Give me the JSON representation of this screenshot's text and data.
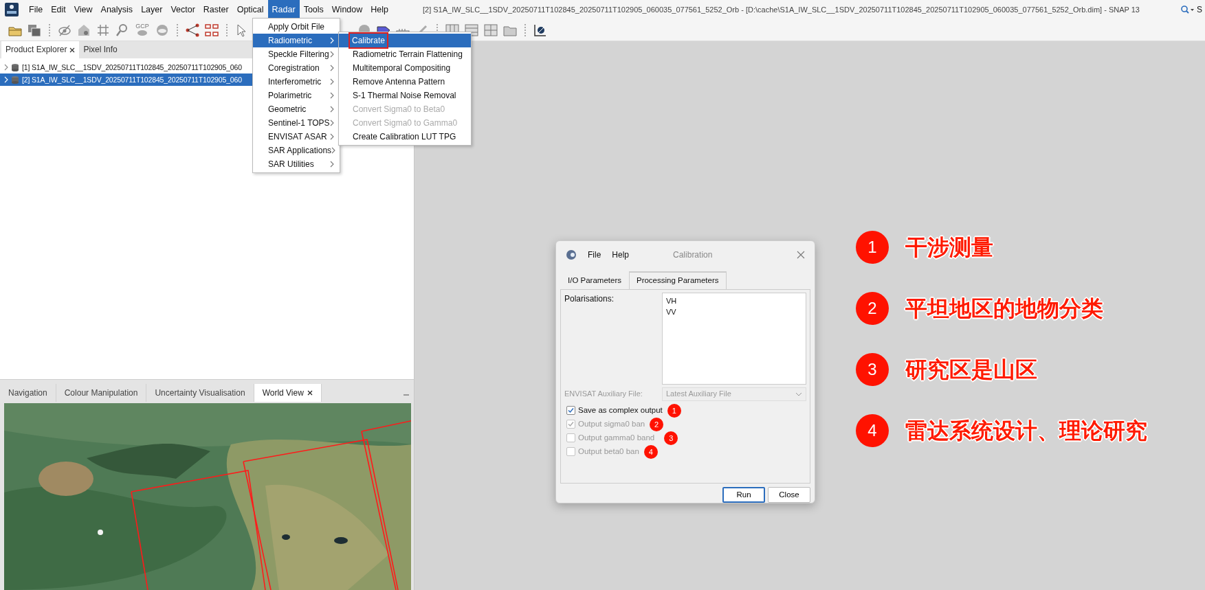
{
  "window": {
    "title": "[2] S1A_IW_SLC__1SDV_20250711T102845_20250711T102905_060035_077561_5252_Orb - [D:\\cache\\S1A_IW_SLC__1SDV_20250711T102845_20250711T102905_060035_077561_5252_Orb.dim] - SNAP 13"
  },
  "menu_bar": [
    {
      "label": "File",
      "selected": false
    },
    {
      "label": "Edit",
      "selected": false
    },
    {
      "label": "View",
      "selected": false
    },
    {
      "label": "Analysis",
      "selected": false
    },
    {
      "label": "Layer",
      "selected": false
    },
    {
      "label": "Vector",
      "selected": false
    },
    {
      "label": "Raster",
      "selected": false
    },
    {
      "label": "Optical",
      "selected": false
    },
    {
      "label": "Radar",
      "selected": true
    },
    {
      "label": "Tools",
      "selected": false
    },
    {
      "label": "Window",
      "selected": false
    },
    {
      "label": "Help",
      "selected": false
    }
  ],
  "toolbar": {
    "gcp_label": "GCP"
  },
  "search": {
    "placeholder": "S"
  },
  "radar_menu": [
    {
      "label": "Apply Orbit File",
      "submenu": false,
      "selected": false
    },
    {
      "label": "Radiometric",
      "submenu": true,
      "selected": true
    },
    {
      "label": "Speckle Filtering",
      "submenu": true,
      "selected": false
    },
    {
      "label": "Coregistration",
      "submenu": true,
      "selected": false
    },
    {
      "label": "Interferometric",
      "submenu": true,
      "selected": false
    },
    {
      "label": "Polarimetric",
      "submenu": true,
      "selected": false
    },
    {
      "label": "Geometric",
      "submenu": true,
      "selected": false
    },
    {
      "label": "Sentinel-1 TOPS",
      "submenu": true,
      "selected": false
    },
    {
      "label": "ENVISAT ASAR",
      "submenu": true,
      "selected": false
    },
    {
      "label": "SAR Applications",
      "submenu": true,
      "selected": false
    },
    {
      "label": "SAR Utilities",
      "submenu": true,
      "selected": false
    }
  ],
  "radiometric_submenu": [
    {
      "label": "Calibrate",
      "selected": true,
      "highlighted": true,
      "disabled": false
    },
    {
      "label": "Radiometric Terrain Flattening",
      "selected": false,
      "highlighted": false,
      "disabled": false
    },
    {
      "label": "Multitemporal Compositing",
      "selected": false,
      "highlighted": false,
      "disabled": false
    },
    {
      "label": "Remove Antenna Pattern",
      "selected": false,
      "highlighted": false,
      "disabled": false
    },
    {
      "label": "S-1 Thermal Noise Removal",
      "selected": false,
      "highlighted": false,
      "disabled": false
    },
    {
      "label": "Convert Sigma0 to Beta0",
      "selected": false,
      "highlighted": false,
      "disabled": true
    },
    {
      "label": "Convert Sigma0 to Gamma0",
      "selected": false,
      "highlighted": false,
      "disabled": true
    },
    {
      "label": "Create Calibration LUT TPG",
      "selected": false,
      "highlighted": false,
      "disabled": false
    }
  ],
  "product_explorer": {
    "tabs": [
      {
        "label": "Product Explorer",
        "closable": true,
        "selected": true
      },
      {
        "label": "Pixel Info",
        "closable": false,
        "selected": false
      }
    ],
    "products": [
      {
        "label": "[1] S1A_IW_SLC__1SDV_20250711T102845_20250711T102905_060",
        "selected": false
      },
      {
        "label": "[2] S1A_IW_SLC__1SDV_20250711T102845_20250711T102905_060",
        "selected": true
      }
    ]
  },
  "bottom_panel": {
    "tabs": [
      {
        "label": "Navigation",
        "closable": false,
        "selected": false
      },
      {
        "label": "Colour Manipulation",
        "closable": false,
        "selected": false
      },
      {
        "label": "Uncertainty Visualisation",
        "closable": false,
        "selected": false
      },
      {
        "label": "World View",
        "closable": true,
        "selected": true
      }
    ]
  },
  "dialog": {
    "menu": [
      "File",
      "Help"
    ],
    "title": "Calibration",
    "tabs": [
      {
        "label": "I/O Parameters",
        "selected": false
      },
      {
        "label": "Processing Parameters",
        "selected": true
      }
    ],
    "polarisations_label": "Polarisations:",
    "polarisations": [
      "VH",
      "VV"
    ],
    "aux_label": "ENVISAT Auxiliary File:",
    "aux_value": "Latest Auxiliary File",
    "aux_disabled": true,
    "options": [
      {
        "label": "Save as complex output",
        "checked": true,
        "disabled": false,
        "badge": "1"
      },
      {
        "label": "Output sigma0 ban",
        "checked": true,
        "disabled": true,
        "badge": "2"
      },
      {
        "label": "Output gamma0 band",
        "checked": false,
        "disabled": true,
        "badge": "3"
      },
      {
        "label": "Output beta0 ban",
        "checked": false,
        "disabled": true,
        "badge": "4"
      }
    ],
    "buttons": [
      {
        "label": "Run",
        "focused": true
      },
      {
        "label": "Close",
        "focused": false
      }
    ]
  },
  "annotations": [
    {
      "number": "1",
      "text": "干涉测量"
    },
    {
      "number": "2",
      "text": "平坦地区的地物分类"
    },
    {
      "number": "3",
      "text": "研究区是山区"
    },
    {
      "number": "4",
      "text": "雷达系统设计、理论研究"
    }
  ]
}
